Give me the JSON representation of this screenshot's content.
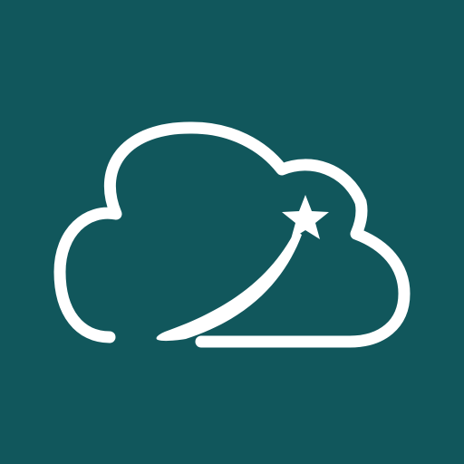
{
  "icon": {
    "name": "cloud-with-shooting-star-icon",
    "background_color": "#11575c",
    "foreground_color": "#ffffff"
  }
}
